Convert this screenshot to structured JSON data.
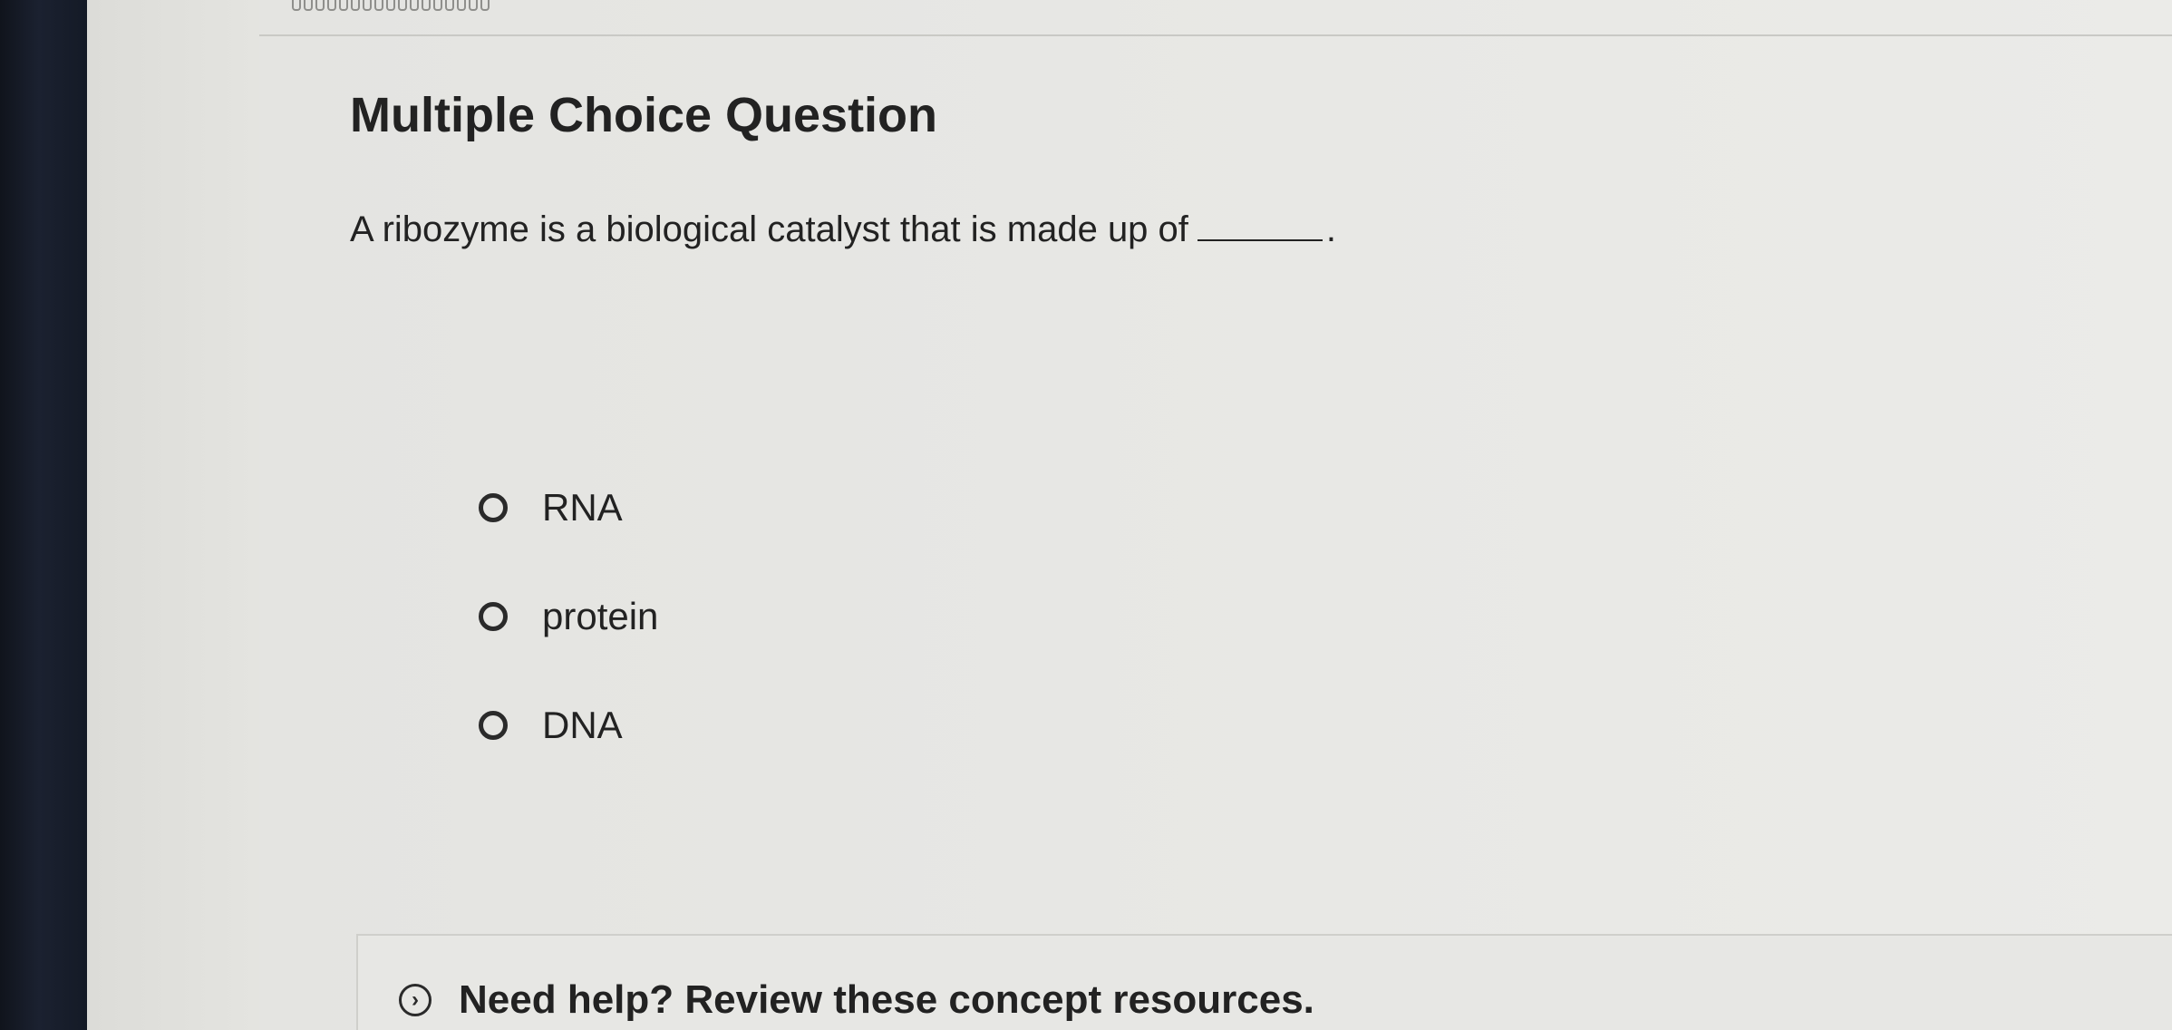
{
  "header": {
    "title": "Multiple Choice Question"
  },
  "question": {
    "prompt": "A ribozyme is a biological catalyst that is made up of",
    "suffix": "."
  },
  "options": [
    {
      "label": "RNA"
    },
    {
      "label": "protein"
    },
    {
      "label": "DNA"
    }
  ],
  "help": {
    "label": "Need help? Review these concept resources.",
    "icon": "chevron-right-icon"
  },
  "colors": {
    "text": "#222222",
    "background": "#e6e6e3"
  }
}
